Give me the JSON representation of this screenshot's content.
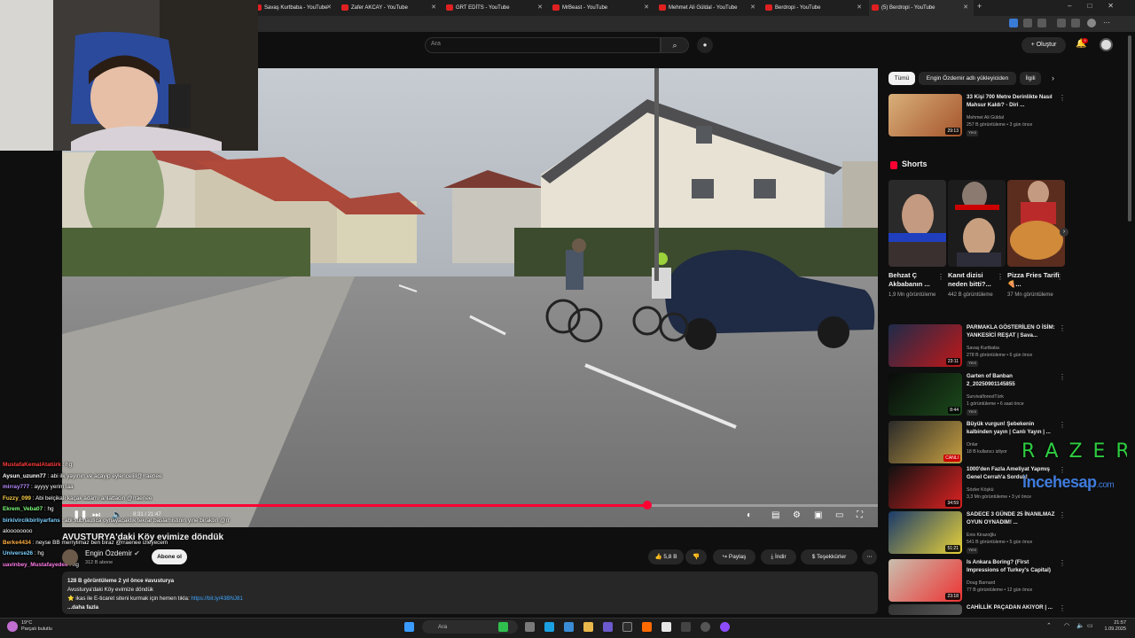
{
  "tabs": [
    {
      "label": "Savaş Kurtbaba - YouTube"
    },
    {
      "label": "Zafer AKCAY - YouTube"
    },
    {
      "label": "GRT EDİTS - YouTube"
    },
    {
      "label": "MrBeast - YouTube"
    },
    {
      "label": "Mehmet Ali Güldal - YouTube"
    },
    {
      "label": "Berdropi - YouTube"
    },
    {
      "label": "(5) Berdropi - YouTube"
    }
  ],
  "header": {
    "search_placeholder": "Ara",
    "create_label": "Oluştur",
    "notification_count": "9"
  },
  "player": {
    "time": "8:31 / 21:47",
    "progress": 0.717
  },
  "chat": [
    {
      "user": "MustafaKemalAtatürk",
      "msg": " : hg",
      "color": "#ff3b3b"
    },
    {
      "user": "Aysun_uzunn77",
      "msg": " : abi ilk yayının ve acayip eylencelill@rraenee",
      "color": "#ffffff"
    },
    {
      "user": "mirray777",
      "msg": " : ayyyy yerim laa",
      "color": "#b98bff"
    },
    {
      "user": "Fuzzy_099",
      "msg": " : Abi belçikalı kaçak adamı anlattacin @rraenee",
      "color": "#ffd24a"
    },
    {
      "user": "Ekrem_Veba07",
      "msg": " : hg",
      "color": "#7dff7d"
    },
    {
      "user": "birkivircikbirliyarfans",
      "msg": " : abi subnautica oynayacaktık tekrar baslamistinin yine biraktın @rr",
      "color": "#7ad0ff"
    },
    {
      "user": "",
      "msg": "aloooooooo",
      "color": "#ffffff"
    },
    {
      "user": "Berke4434",
      "msg": " : neyse BB merrylimaz ben biraz @rraenee izleyecem",
      "color": "#ffae42"
    },
    {
      "user": "Universe26",
      "msg": " : hg",
      "color": "#7ad0ff"
    },
    {
      "user": "uavinbey_Mustafayedek",
      "msg": " : hg",
      "color": "#ff7de9"
    }
  ],
  "video": {
    "title": "AVUSTURYA'daki Köy evimize döndük",
    "channel": "Engin Özdemir",
    "subs": "312 B abone",
    "subscribe_label": "Abone ol",
    "likes": "5,8 B",
    "share_label": "Paylaş",
    "download_label": "İndir",
    "thanks_label": "Teşekkürler",
    "desc_meta": "128 B görüntüleme  2 yıl önce  #avusturya",
    "desc_line1": "Avusturya'daki Köy evimize döndük",
    "desc_line2_prefix": "⭐ ikas ile E-ticaret siteni kurmak için hemen tıkla: ",
    "desc_link": "https://bit.ly/43BNJ81",
    "desc_more": "...daha fazla"
  },
  "chips": [
    {
      "label": "Tümü"
    },
    {
      "label": "Engin Özdemir adlı yükleyiciden"
    },
    {
      "label": "İlgili"
    }
  ],
  "shorts_header": "Shorts",
  "shorts": [
    {
      "title": "Behzat Ç Akbabanın ...",
      "views": "1,9 Mn görüntüleme"
    },
    {
      "title": "Kanıt dizisi neden bitti?...",
      "views": "442 B görüntüleme"
    },
    {
      "title": "Pizza Fries Tarifi 🍕...",
      "views": "37 Mn görüntüleme"
    }
  ],
  "recs": [
    {
      "title": "33 Kişi 700 Metre Derinlikte Nasıl Mahsur Kaldı? - Diri ...",
      "channel": "Mehmet Ali Güldal",
      "meta": "257 B görüntüleme • 3 gün önce",
      "duration": "29:13",
      "badge": "Yeni"
    },
    {
      "title": "PARMAKLA GÖSTERİLEN O İSİM: YANKESİCİ REŞAT | Sava...",
      "channel": "Savaş Kurtbaba",
      "meta": "278 B görüntüleme • 6 gün önce",
      "duration": "23:11",
      "badge": "Yeni"
    },
    {
      "title": "Garten of Banban 2_20250901145855",
      "channel": "SurvivalforestTürk",
      "meta": "1 görüntüleme • 6 saat önce",
      "duration": "8:44",
      "badge": "Yeni"
    },
    {
      "title": "Büyük vurgun! Şebekenin kalbinden yayın | Canlı Yayın | ...",
      "channel": "Onlar",
      "meta": "18 B kullanıcı izliyor",
      "duration": "CANLI",
      "badge": ""
    },
    {
      "title": "1000'den Fazla Ameliyat Yapmış Genel Cerrah'a Sorduk!",
      "channel": "Sözler Köşkü",
      "meta": "3,3 Mn görüntüleme • 3 yıl önce",
      "duration": "34:59",
      "badge": ""
    },
    {
      "title": "SADECE 3 GÜNDE 25 İNANILMAZ OYUN OYNADIM! ...",
      "channel": "Enis Kirazoğlu",
      "meta": "541 B görüntüleme • 5 gün önce",
      "duration": "51:21",
      "badge": "Yeni"
    },
    {
      "title": "Is Ankara Boring? (First Impressions of Turkey's Capital)",
      "channel": "Doug Barnard",
      "meta": "77 B görüntüleme • 12 gün önce",
      "duration": "23:18",
      "badge": ""
    },
    {
      "title": "CAHİLLİK PAÇADAN AKIYOR | ...",
      "channel": "",
      "meta": "",
      "duration": "",
      "badge": ""
    }
  ],
  "watermark": {
    "razer": "RAZER",
    "brand": "incehesap",
    "tld": ".com"
  },
  "taskbar": {
    "weather_temp": "19°C",
    "weather_desc": "Parçalı bulutlu",
    "search_label": "Ara",
    "time": "21:57",
    "date": "1.09.2025"
  },
  "colors": {
    "accent": "#ff0033",
    "link": "#3ea6ff",
    "razer": "#2ecc40"
  }
}
